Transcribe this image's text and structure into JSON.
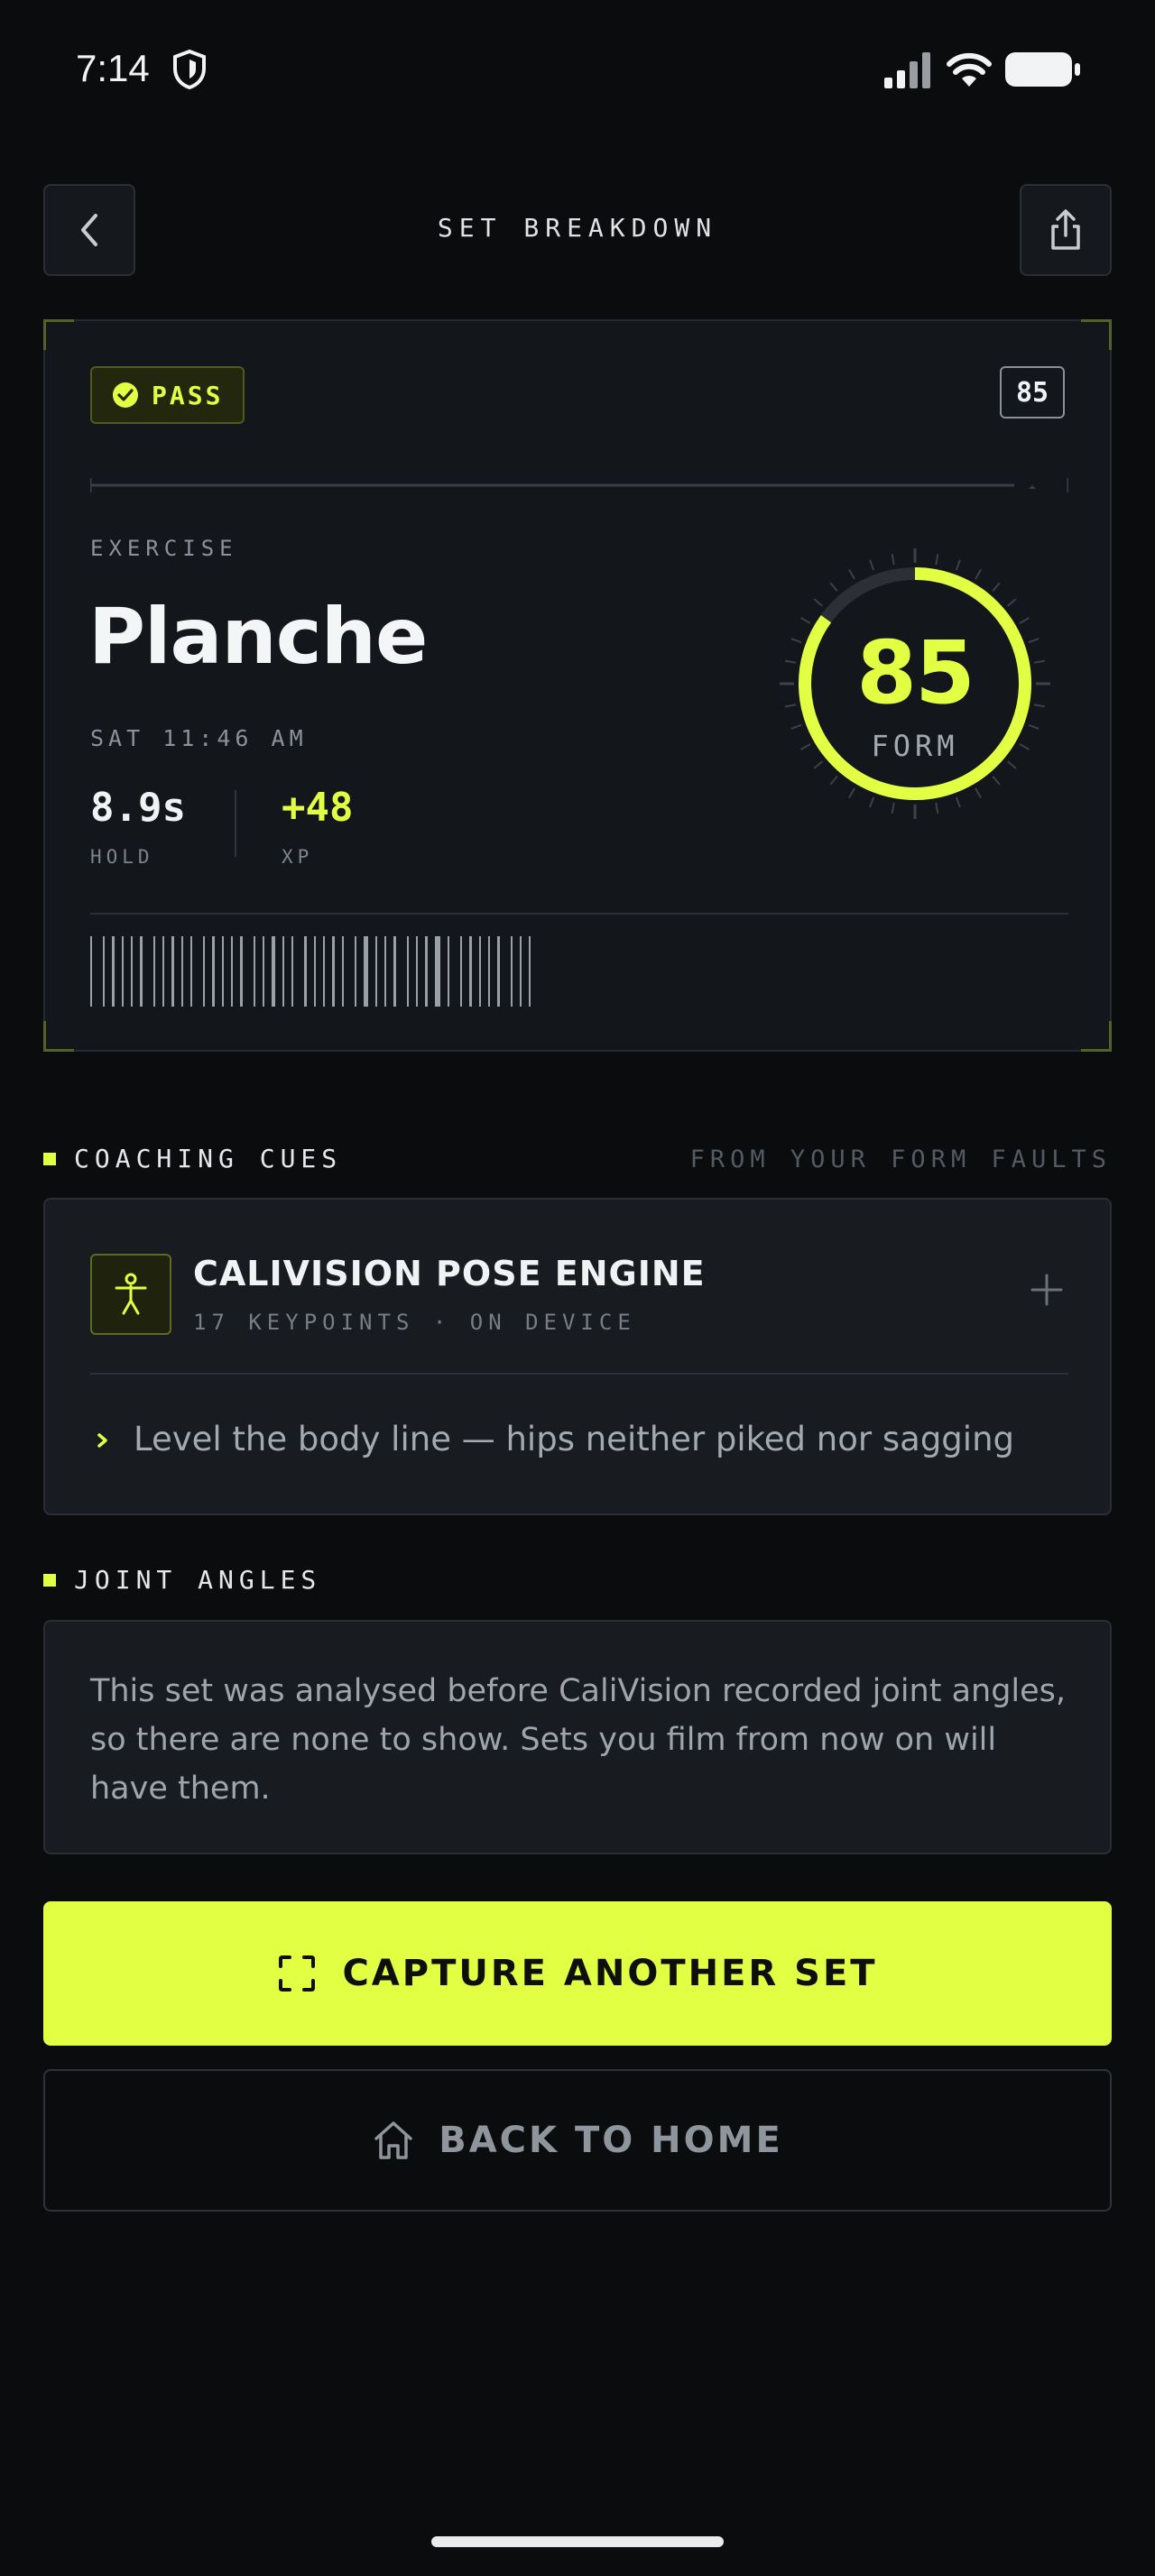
{
  "status_bar": {
    "time": "7:14"
  },
  "header": {
    "title": "SET BREAKDOWN"
  },
  "result": {
    "badge": "PASS",
    "score_chip": "85",
    "exercise_label": "EXERCISE",
    "exercise_name": "Planche",
    "datetime": "SAT 11:46 AM",
    "hold_value": "8.9s",
    "hold_label": "HOLD",
    "xp_value": "+48",
    "xp_label": "XP",
    "form_score": "85",
    "form_label": "FORM",
    "form_fraction": 0.85
  },
  "coaching": {
    "title": "COACHING CUES",
    "subtitle": "FROM YOUR FORM FAULTS",
    "engine_title": "CALIVISION POSE ENGINE",
    "engine_subtitle": "17 KEYPOINTS · ON DEVICE",
    "cue": "Level the body line — hips neither piked nor sagging"
  },
  "joint_angles": {
    "title": "JOINT ANGLES",
    "message": "This set was analysed before CaliVision recorded joint angles, so there are none to show. Sets you film from now on will have them."
  },
  "actions": {
    "primary": "CAPTURE ANOTHER SET",
    "secondary": "BACK TO HOME"
  },
  "colors": {
    "accent": "#e3ff44",
    "background": "#0b0c0e",
    "card": "#13161a"
  }
}
